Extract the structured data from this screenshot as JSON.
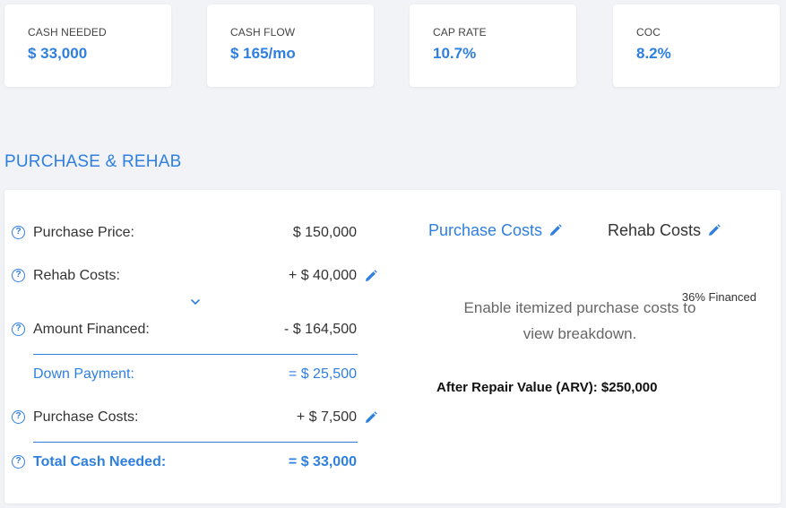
{
  "metrics": [
    {
      "label": "CASH NEEDED",
      "value": "$ 33,000"
    },
    {
      "label": "CASH FLOW",
      "value": "$ 165/mo"
    },
    {
      "label": "CAP RATE",
      "value": "10.7%"
    },
    {
      "label": "COC",
      "value": "8.2%"
    }
  ],
  "section_title": "PURCHASE & REHAB",
  "rows": {
    "purchase_price": {
      "label": "Purchase Price:",
      "value": "$ 150,000"
    },
    "rehab_costs": {
      "label": "Rehab Costs:",
      "value": "+ $ 40,000",
      "note": "36% Financed"
    },
    "amount_financed": {
      "label": "Amount Financed:",
      "value": "- $ 164,500"
    },
    "down_payment": {
      "label": "Down Payment:",
      "value": "= $ 25,500"
    },
    "purchase_costs": {
      "label": "Purchase Costs:",
      "value": "+ $ 7,500"
    },
    "total_cash_needed": {
      "label": "Total Cash Needed:",
      "value": "= $ 33,000"
    }
  },
  "tabs": [
    {
      "label": "Purchase Costs",
      "active": true
    },
    {
      "label": "Rehab Costs",
      "active": false
    }
  ],
  "empty_message_line1": "Enable itemized purchase costs to",
  "empty_message_line2": "view breakdown.",
  "arv_text": "After Repair Value (ARV): $250,000",
  "icons": {
    "help": "question-circle-icon",
    "edit": "pencil-icon",
    "expand": "chevron-down-icon"
  },
  "colors": {
    "accent": "#2f7fe0",
    "background": "#f1f3f7",
    "card": "#ffffff"
  }
}
